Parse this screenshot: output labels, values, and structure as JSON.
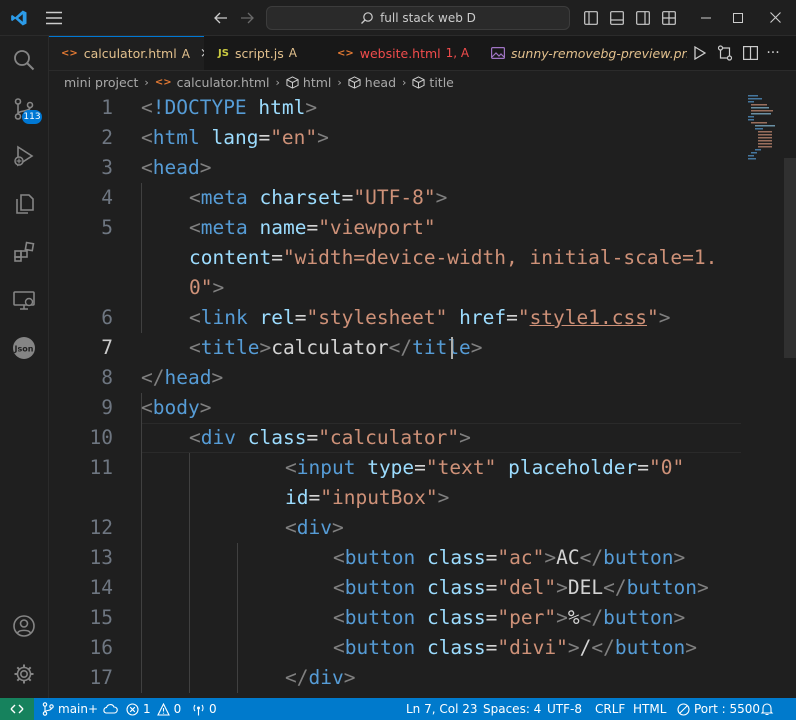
{
  "window": {
    "search_text": "full stack web D"
  },
  "activity": {
    "source_control_badge": "113"
  },
  "tabs": [
    {
      "label": "calculator.html",
      "status": "A",
      "icon": "<>",
      "icon_color": "#e37933",
      "label_color": "#e2c08d",
      "status_color": "#e2c08d",
      "active": true
    },
    {
      "label": "script.js",
      "status": "A",
      "icon": "JS",
      "icon_color": "#cbcb41",
      "label_color": "#e2c08d",
      "status_color": "#e2c08d",
      "active": false
    },
    {
      "label": "website.html",
      "status": "1, A",
      "icon": "<>",
      "icon_color": "#e37933",
      "label_color": "#f14c4c",
      "status_color": "#f14c4c",
      "active": false
    },
    {
      "label": "sunny-removebg-preview.png",
      "status": "",
      "icon": "img",
      "icon_color": "#a074c4",
      "label_color": "#e2c08d",
      "status_color": "#e2c08d",
      "active": false
    }
  ],
  "breadcrumb": [
    {
      "label": "mini project",
      "icon": ""
    },
    {
      "label": "calculator.html",
      "icon": "<>"
    },
    {
      "label": "html",
      "icon": "cube"
    },
    {
      "label": "head",
      "icon": "cube"
    },
    {
      "label": "title",
      "icon": "cube"
    }
  ],
  "editor": {
    "current_line": "7",
    "lines": [
      {
        "n": "1",
        "indent": 0,
        "tokens": [
          [
            "p",
            "<"
          ],
          [
            "tag",
            "!DOCTYPE"
          ],
          [
            "txt",
            " "
          ],
          [
            "attr",
            "html"
          ],
          [
            "p",
            ">"
          ]
        ]
      },
      {
        "n": "2",
        "indent": 0,
        "tokens": [
          [
            "p",
            "<"
          ],
          [
            "tag",
            "html"
          ],
          [
            "txt",
            " "
          ],
          [
            "attr",
            "lang"
          ],
          [
            "txt",
            "="
          ],
          [
            "str",
            "\"en\""
          ],
          [
            "p",
            ">"
          ]
        ]
      },
      {
        "n": "3",
        "indent": 0,
        "tokens": [
          [
            "p",
            "<"
          ],
          [
            "tag",
            "head"
          ],
          [
            "p",
            ">"
          ]
        ]
      },
      {
        "n": "4",
        "indent": 1,
        "tokens": [
          [
            "p",
            "<"
          ],
          [
            "tag",
            "meta"
          ],
          [
            "txt",
            " "
          ],
          [
            "attr",
            "charset"
          ],
          [
            "txt",
            "="
          ],
          [
            "str",
            "\"UTF-8\""
          ],
          [
            "p",
            ">"
          ]
        ]
      },
      {
        "n": "5",
        "indent": 1,
        "tokens": [
          [
            "p",
            "<"
          ],
          [
            "tag",
            "meta"
          ],
          [
            "txt",
            " "
          ],
          [
            "attr",
            "name"
          ],
          [
            "txt",
            "="
          ],
          [
            "str",
            "\"viewport\""
          ]
        ]
      },
      {
        "n": "",
        "indent": 1,
        "tokens": [
          [
            "attr",
            "content"
          ],
          [
            "txt",
            "="
          ],
          [
            "str",
            "\"width=device-width, initial-scale=1."
          ]
        ]
      },
      {
        "n": "",
        "indent": 1,
        "tokens": [
          [
            "str",
            "0\""
          ],
          [
            "p",
            ">"
          ]
        ]
      },
      {
        "n": "6",
        "indent": 1,
        "tokens": [
          [
            "p",
            "<"
          ],
          [
            "tag",
            "link"
          ],
          [
            "txt",
            " "
          ],
          [
            "attr",
            "rel"
          ],
          [
            "txt",
            "="
          ],
          [
            "str",
            "\"stylesheet\""
          ],
          [
            "txt",
            " "
          ],
          [
            "attr",
            "href"
          ],
          [
            "txt",
            "="
          ],
          [
            "str",
            "\""
          ],
          [
            "link",
            "style1.css"
          ],
          [
            "str",
            "\""
          ],
          [
            "p",
            ">"
          ]
        ]
      },
      {
        "n": "7",
        "indent": 1,
        "tokens": [
          [
            "p",
            "<"
          ],
          [
            "tag",
            "title"
          ],
          [
            "p",
            ">"
          ],
          [
            "txt",
            "calculator"
          ],
          [
            "p",
            "</"
          ],
          [
            "tag",
            "title"
          ],
          [
            "p",
            ">"
          ]
        ]
      },
      {
        "n": "8",
        "indent": 0,
        "tokens": [
          [
            "p",
            "</"
          ],
          [
            "tag",
            "head"
          ],
          [
            "p",
            ">"
          ]
        ]
      },
      {
        "n": "9",
        "indent": 0,
        "tokens": [
          [
            "p",
            "<"
          ],
          [
            "tag",
            "body"
          ],
          [
            "p",
            ">"
          ]
        ]
      },
      {
        "n": "10",
        "indent": 1,
        "tokens": [
          [
            "p",
            "<"
          ],
          [
            "tag",
            "div"
          ],
          [
            "txt",
            " "
          ],
          [
            "attr",
            "class"
          ],
          [
            "txt",
            "="
          ],
          [
            "str",
            "\"calculator\""
          ],
          [
            "p",
            ">"
          ]
        ]
      },
      {
        "n": "11",
        "indent": 3,
        "tokens": [
          [
            "p",
            "<"
          ],
          [
            "tag",
            "input"
          ],
          [
            "txt",
            " "
          ],
          [
            "attr",
            "type"
          ],
          [
            "txt",
            "="
          ],
          [
            "str",
            "\"text\""
          ],
          [
            "txt",
            " "
          ],
          [
            "attr",
            "placeholder"
          ],
          [
            "txt",
            "="
          ],
          [
            "str",
            "\"0\""
          ]
        ]
      },
      {
        "n": "",
        "indent": 3,
        "tokens": [
          [
            "attr",
            "id"
          ],
          [
            "txt",
            "="
          ],
          [
            "str",
            "\"inputBox\""
          ],
          [
            "p",
            ">"
          ]
        ]
      },
      {
        "n": "12",
        "indent": 3,
        "tokens": [
          [
            "p",
            "<"
          ],
          [
            "tag",
            "div"
          ],
          [
            "p",
            ">"
          ]
        ]
      },
      {
        "n": "13",
        "indent": 4,
        "tokens": [
          [
            "p",
            "<"
          ],
          [
            "tag",
            "button"
          ],
          [
            "txt",
            " "
          ],
          [
            "attr",
            "class"
          ],
          [
            "txt",
            "="
          ],
          [
            "str",
            "\"ac\""
          ],
          [
            "p",
            ">"
          ],
          [
            "txt",
            "AC"
          ],
          [
            "p",
            "</"
          ],
          [
            "tag",
            "button"
          ],
          [
            "p",
            ">"
          ]
        ]
      },
      {
        "n": "14",
        "indent": 4,
        "tokens": [
          [
            "p",
            "<"
          ],
          [
            "tag",
            "button"
          ],
          [
            "txt",
            " "
          ],
          [
            "attr",
            "class"
          ],
          [
            "txt",
            "="
          ],
          [
            "str",
            "\"del\""
          ],
          [
            "p",
            ">"
          ],
          [
            "txt",
            "DEL"
          ],
          [
            "p",
            "</"
          ],
          [
            "tag",
            "button"
          ],
          [
            "p",
            ">"
          ]
        ]
      },
      {
        "n": "15",
        "indent": 4,
        "tokens": [
          [
            "p",
            "<"
          ],
          [
            "tag",
            "button"
          ],
          [
            "txt",
            " "
          ],
          [
            "attr",
            "class"
          ],
          [
            "txt",
            "="
          ],
          [
            "str",
            "\"per\""
          ],
          [
            "p",
            ">"
          ],
          [
            "txt",
            "%"
          ],
          [
            "p",
            "</"
          ],
          [
            "tag",
            "button"
          ],
          [
            "p",
            ">"
          ]
        ]
      },
      {
        "n": "16",
        "indent": 4,
        "tokens": [
          [
            "p",
            "<"
          ],
          [
            "tag",
            "button"
          ],
          [
            "txt",
            " "
          ],
          [
            "attr",
            "class"
          ],
          [
            "txt",
            "="
          ],
          [
            "str",
            "\"divi\""
          ],
          [
            "p",
            ">"
          ],
          [
            "txt",
            "/"
          ],
          [
            "p",
            "</"
          ],
          [
            "tag",
            "button"
          ],
          [
            "p",
            ">"
          ]
        ]
      },
      {
        "n": "17",
        "indent": 3,
        "tokens": [
          [
            "p",
            "</"
          ],
          [
            "tag",
            "div"
          ],
          [
            "p",
            ">"
          ]
        ]
      }
    ]
  },
  "status": {
    "branch": "main+",
    "errors": "1",
    "warnings": "0",
    "ports": "0",
    "position": "Ln 7, Col 23",
    "spaces": "Spaces: 4",
    "encoding": "UTF-8",
    "eol": "CRLF",
    "language": "HTML",
    "live_server": "Port : 5500"
  }
}
